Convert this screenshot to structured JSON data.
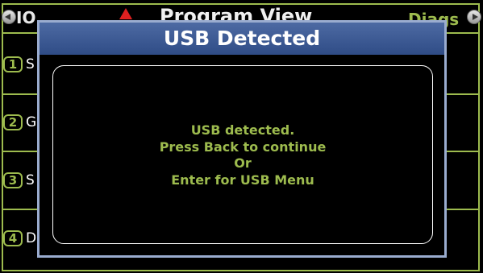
{
  "background": {
    "left_label": "IO",
    "title": "Program View",
    "right_label": "Diags",
    "rows": [
      {
        "key": "1",
        "label": "S"
      },
      {
        "key": "2",
        "label": "G"
      },
      {
        "key": "3",
        "label": "S"
      },
      {
        "key": "4",
        "label": "D"
      }
    ]
  },
  "dialog": {
    "title": "USB Detected",
    "message": [
      "USB detected.",
      "Press Back to continue",
      "Or",
      "Enter for USB Menu"
    ]
  },
  "colors": {
    "accent_green": "#9dbb4e",
    "titlebar_blue": "#3a5894",
    "warning_red": "#e02020"
  }
}
